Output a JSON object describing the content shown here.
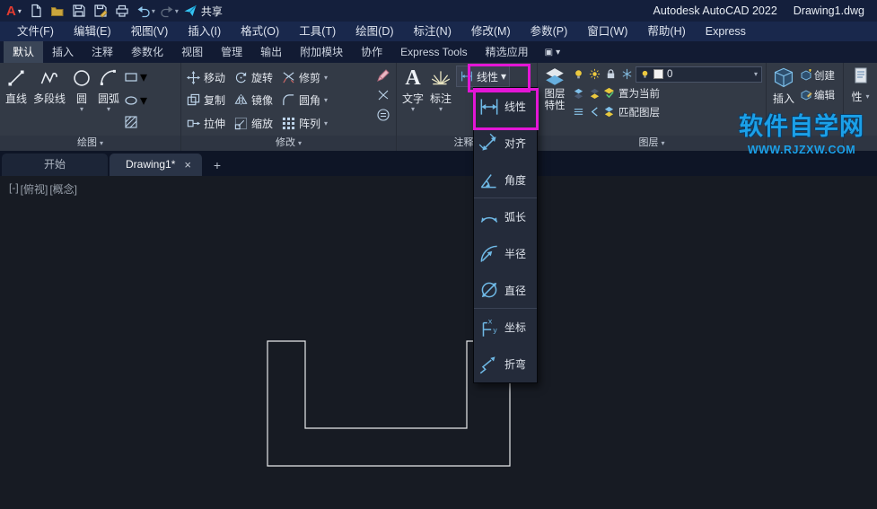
{
  "titlebar": {
    "logo": "A",
    "share_label": "共享",
    "app_title": "Autodesk AutoCAD 2022",
    "doc_title": "Drawing1.dwg"
  },
  "menubar": {
    "items": [
      "文件(F)",
      "编辑(E)",
      "视图(V)",
      "插入(I)",
      "格式(O)",
      "工具(T)",
      "绘图(D)",
      "标注(N)",
      "修改(M)",
      "参数(P)",
      "窗口(W)",
      "帮助(H)",
      "Express"
    ]
  },
  "ribbon_tabs": {
    "active": "默认",
    "items": [
      "默认",
      "插入",
      "注释",
      "参数化",
      "视图",
      "管理",
      "输出",
      "附加模块",
      "协作",
      "Express Tools",
      "精选应用"
    ]
  },
  "draw_panel": {
    "title": "绘图",
    "tools": [
      "直线",
      "多段线",
      "圆",
      "圆弧"
    ]
  },
  "modify_panel": {
    "title": "修改",
    "tools": [
      "移动",
      "旋转",
      "修剪",
      "复制",
      "镜像",
      "圆角",
      "拉伸",
      "缩放",
      "阵列"
    ]
  },
  "annotation_panel": {
    "title": "注释",
    "text_tool": "文字",
    "dim_tool": "标注",
    "linear_button": "线性"
  },
  "layers_panel": {
    "title": "图层",
    "properties_tool": "图层特性",
    "layer_name": "0",
    "set_current": "置为当前",
    "match_layer": "匹配图层"
  },
  "block_panel": {
    "insert": "插入",
    "create": "创建",
    "edit": "编辑",
    "partial": "性"
  },
  "dim_dropdown": {
    "items": [
      {
        "label": "线性"
      },
      {
        "label": "对齐"
      },
      {
        "label": "角度"
      },
      {
        "label": "弧长"
      },
      {
        "label": "半径"
      },
      {
        "label": "直径"
      },
      {
        "label": "坐标"
      },
      {
        "label": "折弯"
      }
    ]
  },
  "file_tabs": {
    "start": "开始",
    "active_doc": "Drawing1*"
  },
  "canvas": {
    "viewport_controls": [
      "[-]",
      "[俯视]",
      "[概念]"
    ]
  },
  "watermark": {
    "line1": "软件自学网",
    "line2": "WWW.RJZXW.COM"
  },
  "icons": {
    "caret_down": "▾",
    "close": "×",
    "new_tab": "+",
    "panel_toggle": "▣"
  },
  "colors": {
    "highlight": "#e316d6",
    "watermark_blue": "#1ba0e8",
    "accent_cyan": "#6fb9e6"
  }
}
